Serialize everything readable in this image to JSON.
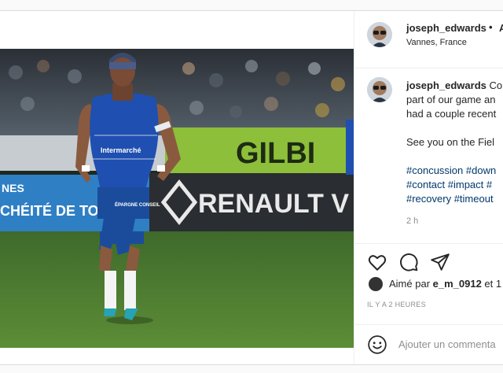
{
  "post": {
    "username": "joseph_edwards",
    "separator": "•",
    "follow_label": "A",
    "location": "Vannes, France",
    "caption": {
      "line1": "Co",
      "line2": "part of our game an",
      "line3": "had a couple recent",
      "line4": "See you on the Fiel",
      "tags_line1": "#concussion #down",
      "tags_line2": "#contact #impact #",
      "tags_line3": "#recovery #timeout"
    },
    "time": "2 h",
    "likes": {
      "prefix": "Aimé par ",
      "user": "e_m_0912",
      "suffix": " et 1"
    },
    "ago": "IL Y A 2 HEURES",
    "comment_placeholder": "Ajouter un commenta"
  },
  "photo": {
    "banner_green": "GILBI",
    "banner_renault": "RENAULT V",
    "banner_left_top": "NES",
    "banner_left_bottom": "CHÉITÉ DE TO",
    "jersey_sponsor": "Intermarché",
    "shorts_sponsor": "ÉPARGNE CONSEIL"
  },
  "colors": {
    "link": "#00376b",
    "muted": "#8e8e8e",
    "jersey_blue": "#1f4fb0",
    "banner_green": "#8dbf3a"
  },
  "icons": [
    "heart-icon",
    "comment-icon",
    "share-icon",
    "emoji-icon"
  ]
}
